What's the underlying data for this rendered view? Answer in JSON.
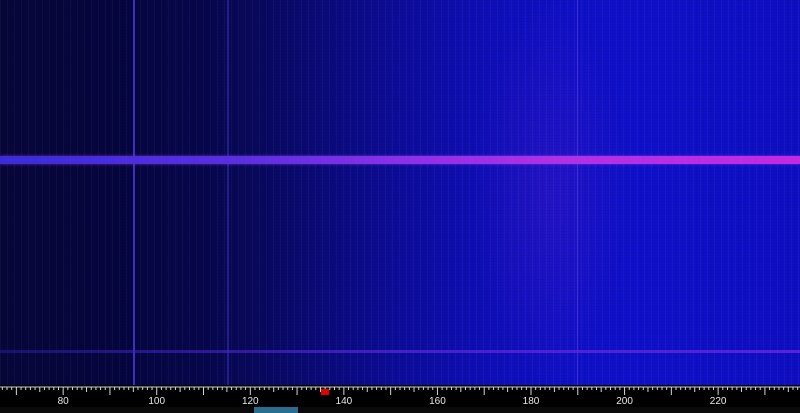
{
  "axis": {
    "ticks": [
      "80",
      "100",
      "120",
      "140",
      "160",
      "180",
      "200",
      "220"
    ],
    "tick_values": [
      80,
      100,
      120,
      140,
      160,
      180,
      200,
      220
    ],
    "range": [
      66.5,
      237.5
    ]
  },
  "marker": {
    "color": "#e00000",
    "value": 136
  },
  "carrier": {
    "color_start": "#3a2bd8",
    "color_end": "#c22ae2"
  },
  "scrollbar": {
    "color": "#2b6d8f"
  }
}
